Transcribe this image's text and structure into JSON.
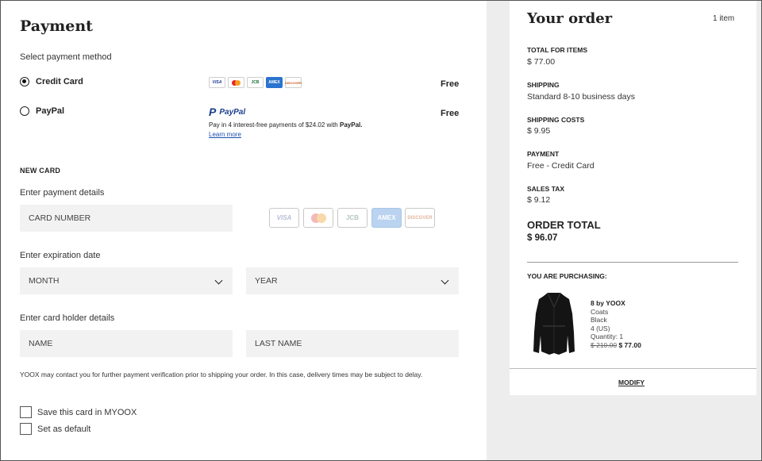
{
  "payment": {
    "title": "Payment",
    "select_method_label": "Select payment method",
    "methods": [
      {
        "name": "Credit Card",
        "price": "Free",
        "selected": true
      },
      {
        "name": "PayPal",
        "price": "Free",
        "selected": false
      }
    ],
    "card_brands": [
      "VISA",
      "MC",
      "JCB",
      "AMEX",
      "DISCOVER"
    ],
    "paypal": {
      "logo_text": "PayPal",
      "installments_text": "Pay in 4 interest-free payments of $24.02 with",
      "installments_brand": "PayPal.",
      "learn_more": "Learn more"
    },
    "new_card_heading": "NEW CARD",
    "enter_details_label": "Enter payment details",
    "card_number_placeholder": "CARD NUMBER",
    "expiration_label": "Enter expiration date",
    "month_placeholder": "MONTH",
    "year_placeholder": "YEAR",
    "holder_label": "Enter card holder details",
    "name_placeholder": "NAME",
    "last_name_placeholder": "LAST NAME",
    "disclaimer": "YOOX may contact you for further payment verification prior to shipping your order. In this case, delivery times may be subject to delay.",
    "save_card_label": "Save this card in MYOOX",
    "set_default_label": "Set as default"
  },
  "order": {
    "title": "Your order",
    "item_count": "1 item",
    "total_items_label": "TOTAL FOR ITEMS",
    "total_items_value": "$ 77.00",
    "shipping_label": "SHIPPING",
    "shipping_value": "Standard 8-10 business days",
    "shipping_costs_label": "SHIPPING COSTS",
    "shipping_costs_value": "$ 9.95",
    "payment_label": "PAYMENT",
    "payment_value": "Free - Credit Card",
    "sales_tax_label": "SALES TAX",
    "sales_tax_value": "$ 9.12",
    "order_total_label": "ORDER TOTAL",
    "order_total_value": "$ 96.07",
    "purchasing_label": "YOU ARE PURCHASING:",
    "product": {
      "brand": "8 by YOOX",
      "category": "Coats",
      "color": "Black",
      "size": "4 (US)",
      "quantity": "Quantity: 1",
      "old_price": "$ 210.00",
      "new_price": "$ 77.00"
    },
    "modify_label": "MODIFY"
  }
}
